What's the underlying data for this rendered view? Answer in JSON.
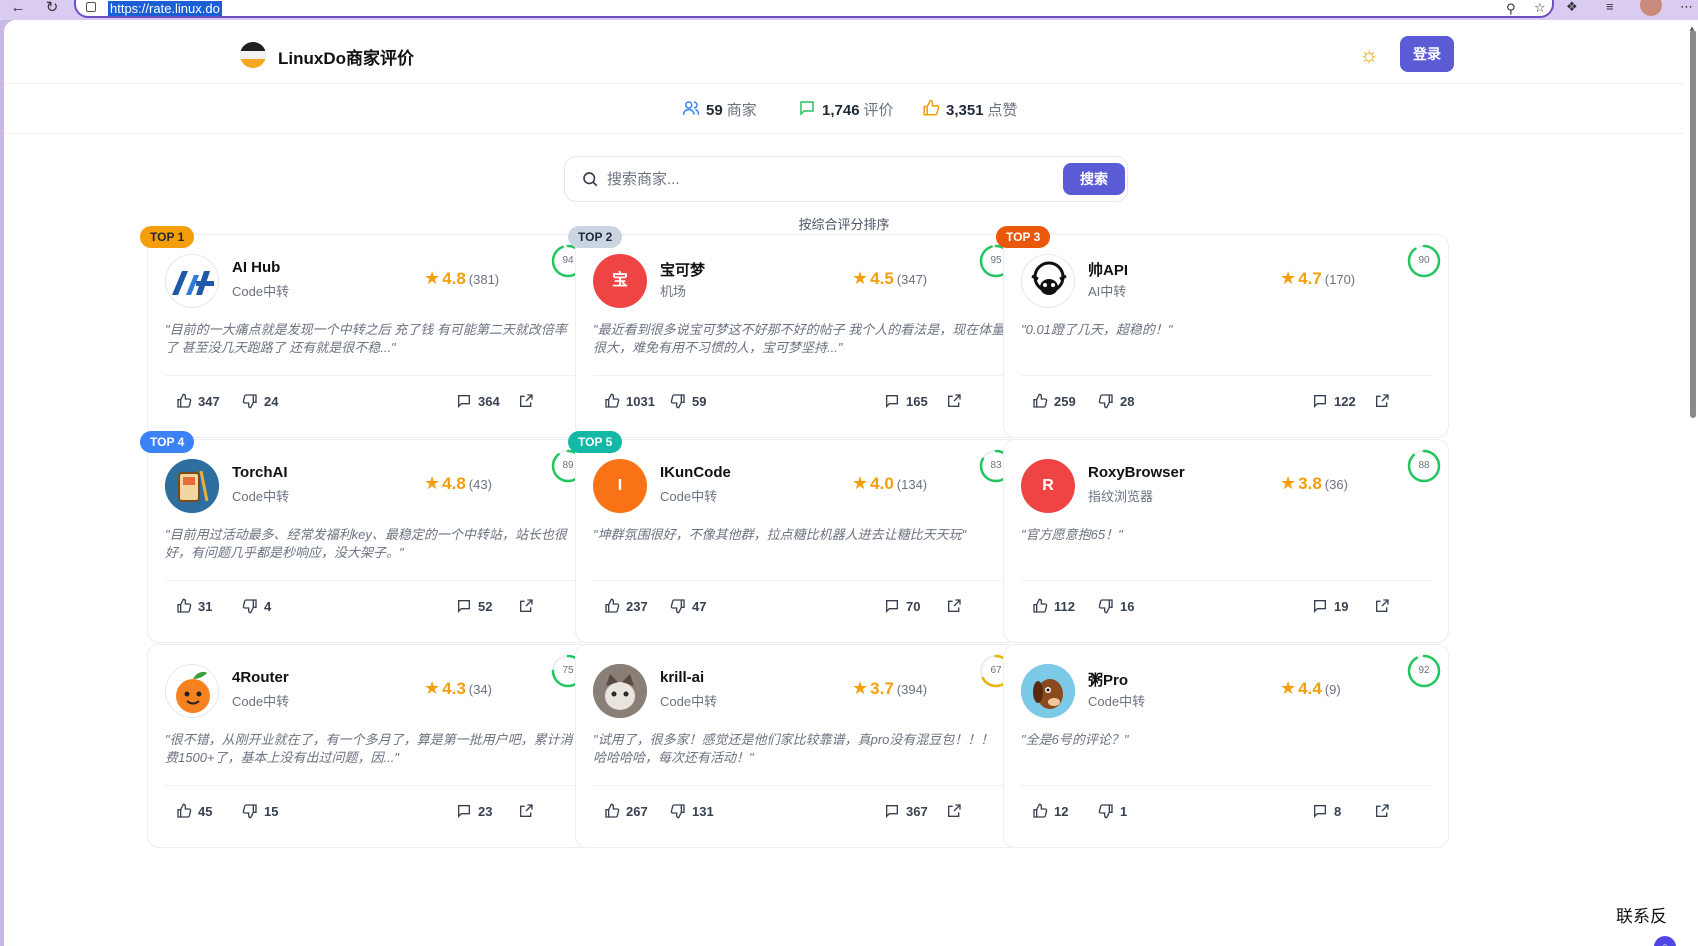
{
  "browser": {
    "url": "https://rate.linux.do"
  },
  "header": {
    "site_title": "LinuxDo商家评价",
    "login_label": "登录"
  },
  "stats": [
    {
      "value": "59",
      "label": "商家",
      "icon": "users-icon",
      "color": "#3b82f6"
    },
    {
      "value": "1,746",
      "label": "评价",
      "icon": "message-icon",
      "color": "#22c55e"
    },
    {
      "value": "3,351",
      "label": "点赞",
      "icon": "thumbs-up-icon",
      "color": "#f59e0b"
    }
  ],
  "search": {
    "placeholder": "搜索商家...",
    "button_label": "搜索"
  },
  "sort_label": "按综合评分排序",
  "colors": {
    "accent": "#5b5bd6",
    "rating": "#f59e0b",
    "ring_high": "#22c55e",
    "ring_mid": "#eab308"
  },
  "merchants": [
    {
      "badge": "TOP 1",
      "badge_color": "#f59e0b",
      "name": "AI Hub",
      "category": "Code中转",
      "rating": "4.8",
      "rating_count": "(381)",
      "score": "94",
      "score_pct": 0.94,
      "ring_color": "#22c55e",
      "avatar": "aihub-logo",
      "avatar_bg": "#ffffff",
      "avatar_text": "",
      "quote": "\"目前的一大痛点就是发现一个中转之后 充了钱 有可能第二天就改倍率了 甚至没几天跑路了 还有就是很不稳...\"",
      "likes": "347",
      "dislikes": "24",
      "comments": "364"
    },
    {
      "badge": "TOP 2",
      "badge_color": "#cbd5e1",
      "name": "宝可梦",
      "category": "机场",
      "rating": "4.5",
      "rating_count": "(347)",
      "score": "95",
      "score_pct": 0.95,
      "ring_color": "#22c55e",
      "avatar": "letter-avatar",
      "avatar_bg": "#ef4444",
      "avatar_text": "宝",
      "quote": "\"最近看到很多说宝可梦这不好那不好的帖子 我个人的看法是，现在体量很大，难免有用不习惯的人，宝可梦坚持...\"",
      "likes": "1031",
      "dislikes": "59",
      "comments": "165"
    },
    {
      "badge": "TOP 3",
      "badge_color": "#ea580c",
      "name": "帅API",
      "category": "AI中转",
      "rating": "4.7",
      "rating_count": "(170)",
      "score": "90",
      "score_pct": 0.9,
      "ring_color": "#22c55e",
      "avatar": "sheep-logo",
      "avatar_bg": "#ffffff",
      "avatar_text": "",
      "quote": "\"0.01蹬了几天，超稳的！\"",
      "likes": "259",
      "dislikes": "28",
      "comments": "122"
    },
    {
      "badge": "TOP 4",
      "badge_color": "#3b82f6",
      "name": "TorchAI",
      "category": "Code中转",
      "rating": "4.8",
      "rating_count": "(43)",
      "score": "89",
      "score_pct": 0.89,
      "ring_color": "#22c55e",
      "avatar": "torch-logo",
      "avatar_bg": "#2f6f9f",
      "avatar_text": "",
      "quote": "\"目前用过活动最多、经常发福利key、最稳定的一个中转站，站长也很好，有问题几乎都是秒响应，没大架子。\"",
      "likes": "31",
      "dislikes": "4",
      "comments": "52"
    },
    {
      "badge": "TOP 5",
      "badge_color": "#14b8a6",
      "name": "IKunCode",
      "category": "Code中转",
      "rating": "4.0",
      "rating_count": "(134)",
      "score": "83",
      "score_pct": 0.83,
      "ring_color": "#22c55e",
      "avatar": "letter-avatar",
      "avatar_bg": "#f97316",
      "avatar_text": "I",
      "quote": "\"坤群氛围很好，不像其他群，拉点糖比机器人进去让糖比天天玩\"",
      "likes": "237",
      "dislikes": "47",
      "comments": "70"
    },
    {
      "badge": "",
      "badge_color": "",
      "name": "RoxyBrowser",
      "category": "指纹浏览器",
      "rating": "3.8",
      "rating_count": "(36)",
      "score": "88",
      "score_pct": 0.88,
      "ring_color": "#22c55e",
      "avatar": "letter-avatar",
      "avatar_bg": "#ef4444",
      "avatar_text": "R",
      "quote": "\"官方愿意抱65！\"",
      "likes": "112",
      "dislikes": "16",
      "comments": "19"
    },
    {
      "badge": "",
      "badge_color": "",
      "name": "4Router",
      "category": "Code中转",
      "rating": "4.3",
      "rating_count": "(34)",
      "score": "75",
      "score_pct": 0.75,
      "ring_color": "#22c55e",
      "avatar": "orange-logo",
      "avatar_bg": "#ffffff",
      "avatar_text": "",
      "quote": "\"很不错，从刚开业就在了，有一个多月了，算是第一批用户吧，累计消费1500+了，基本上没有出过问题，因...\"",
      "likes": "45",
      "dislikes": "15",
      "comments": "23"
    },
    {
      "badge": "",
      "badge_color": "",
      "name": "krill-ai",
      "category": "Code中转",
      "rating": "3.7",
      "rating_count": "(394)",
      "score": "67",
      "score_pct": 0.67,
      "ring_color": "#eab308",
      "avatar": "cat-photo",
      "avatar_bg": "#8a7f76",
      "avatar_text": "",
      "quote": "\"试用了，很多家！感觉还是他们家比较靠谱，真pro没有混豆包！！！哈哈哈哈，每次还有活动！\"",
      "likes": "267",
      "dislikes": "131",
      "comments": "367"
    },
    {
      "badge": "",
      "badge_color": "",
      "name": "粥Pro",
      "category": "Code中转",
      "rating": "4.4",
      "rating_count": "(9)",
      "score": "92",
      "score_pct": 0.92,
      "ring_color": "#22c55e",
      "avatar": "dog-logo",
      "avatar_bg": "#7cc9e8",
      "avatar_text": "",
      "quote": "\"全是6号的评论？\"",
      "likes": "12",
      "dislikes": "1",
      "comments": "8"
    }
  ],
  "floating": {
    "text": "联系反"
  }
}
